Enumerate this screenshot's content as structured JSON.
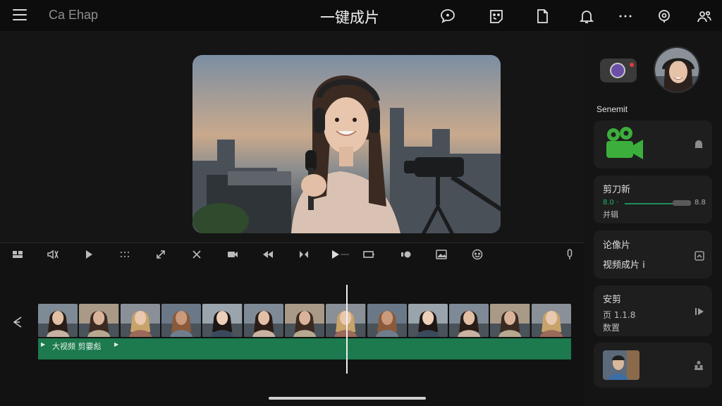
{
  "app": {
    "name": "Ca Ehap",
    "title": "一键成片"
  },
  "top_icons": [
    "chat-icon",
    "sticker-icon",
    "document-icon",
    "bell-icon",
    "more-icon",
    "location-icon",
    "people-icon"
  ],
  "right_panel": {
    "section_label": "Senemit",
    "cards": [
      {
        "title": "",
        "icon": "camera-green-icon"
      },
      {
        "title": "剪刀新",
        "slider_value": "8.0 ·",
        "slider_max": "8.8",
        "slider_level": 0.6,
        "sub": "并辑"
      },
      {
        "title": "论像片",
        "sub": "视频成片 ⅰ"
      },
      {
        "title": "安剪",
        "sub1": "页 1.1.8",
        "sub2": "数置"
      },
      {
        "title": ""
      }
    ]
  },
  "timeline": {
    "clip_count": 13,
    "track_label": "大视频 剪霎彪",
    "play_marker": "▶"
  },
  "colors": {
    "accent": "#1c7a4e",
    "background": "#121212",
    "card": "#1e1e1e"
  }
}
